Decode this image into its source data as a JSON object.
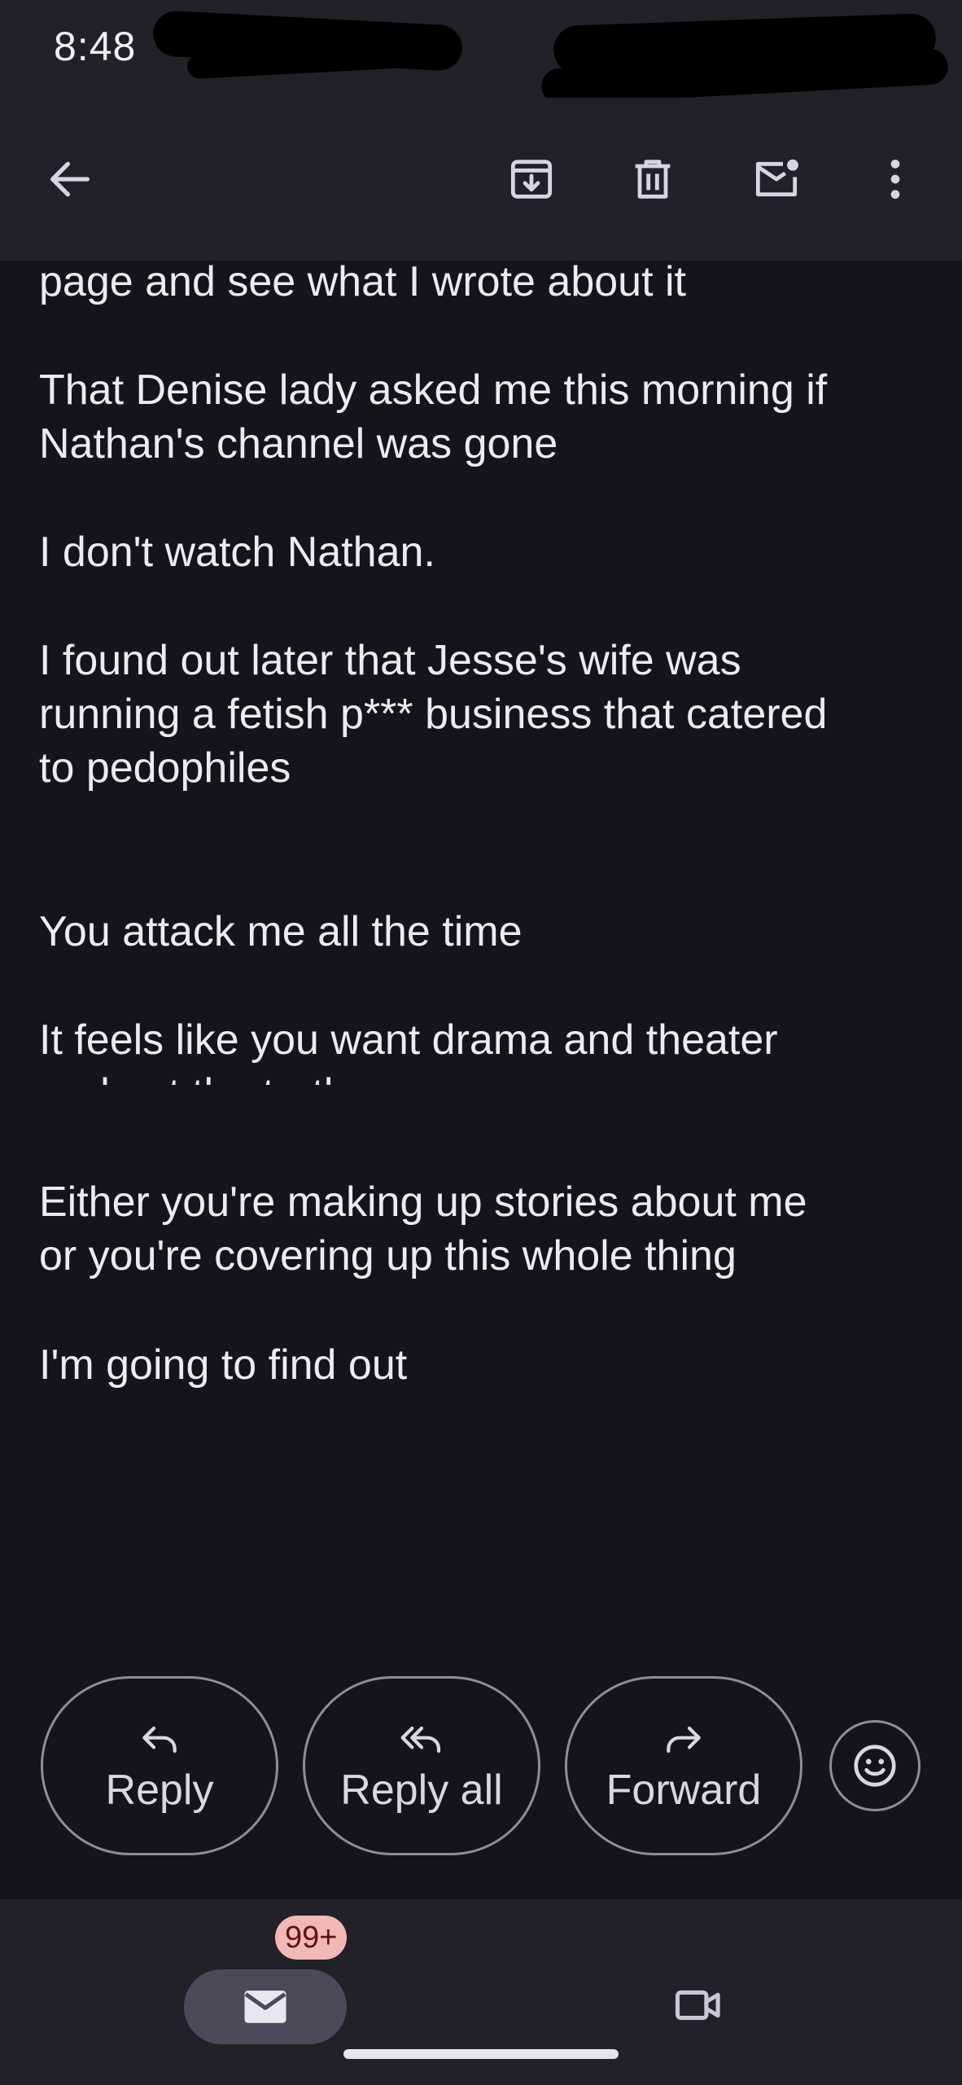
{
  "status_bar": {
    "time": "8:48"
  },
  "toolbar": {
    "back_icon": "arrow-left-icon",
    "archive_icon": "archive-icon",
    "delete_icon": "trash-icon",
    "mark_unread_icon": "mail-unread-icon",
    "more_icon": "more-vert-icon"
  },
  "message": {
    "paragraphs": [
      {
        "lines": [
          "page and see what I wrote about it"
        ]
      },
      {
        "lines": [
          "That Denise lady asked me this morning if",
          "Nathan's channel was gone"
        ]
      },
      {
        "lines": [
          "I don't watch Nathan."
        ]
      },
      {
        "lines": [
          "I found out later that Jesse's wife was",
          "running a fetish p*** business that catered",
          "to pedophiles"
        ]
      },
      {
        "lines": [
          "You attack me all the time"
        ]
      },
      {
        "lines": [
          "It feels like you want drama and theater",
          "and not the truth."
        ]
      },
      {
        "lines": [
          "Either you're making up stories about me",
          "or you're covering up this whole thing"
        ]
      },
      {
        "lines": [
          "I'm going to find out"
        ]
      }
    ]
  },
  "actions": {
    "reply_label": "Reply",
    "reply_all_label": "Reply all",
    "forward_label": "Forward",
    "emoji_icon": "emoji-smile-icon"
  },
  "bottom_nav": {
    "mail_badge": "99+",
    "mail_icon": "mail-icon",
    "meet_icon": "video-camera-icon"
  },
  "colors": {
    "background": "#151419",
    "bar": "#222127",
    "text": "#ecebf0",
    "outline": "#8f8d96",
    "badge": "#f2b8b5",
    "pill": "#4b4a59"
  }
}
